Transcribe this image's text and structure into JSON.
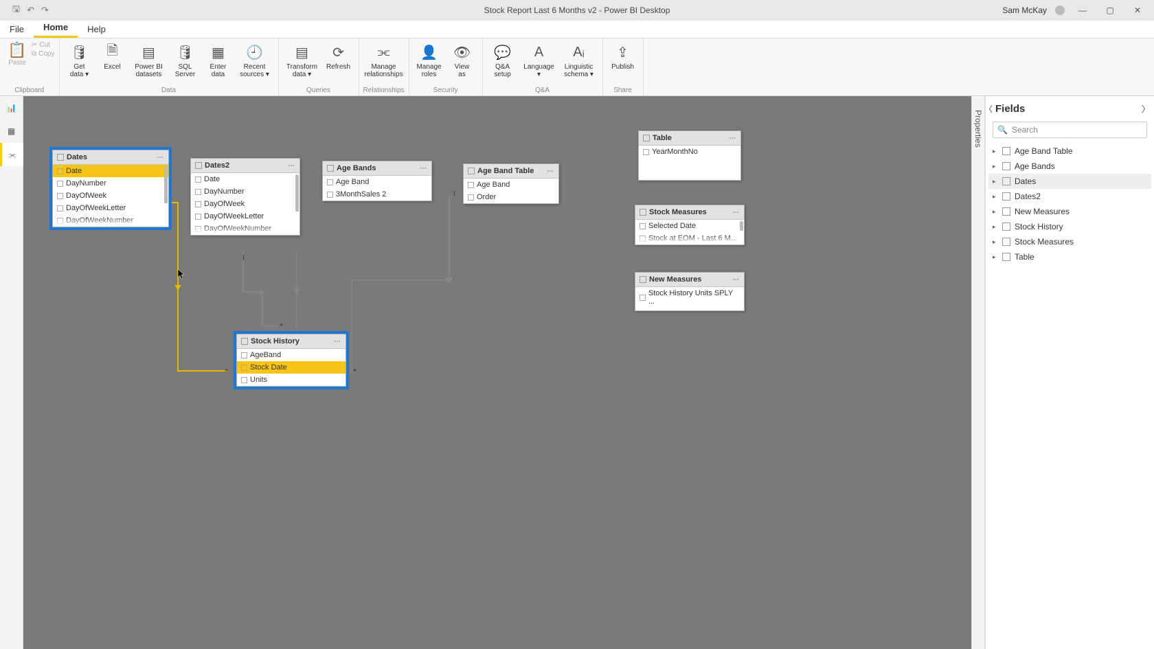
{
  "app": {
    "title": "Stock Report Last 6 Months v2 - Power BI Desktop",
    "user": "Sam McKay"
  },
  "menu": {
    "file": "File",
    "home": "Home",
    "help": "Help"
  },
  "ribbon": {
    "clipboard": {
      "paste": "Paste",
      "cut": "Cut",
      "copy": "Copy",
      "group": "Clipboard"
    },
    "data": {
      "get": "Get\ndata ▾",
      "excel": "Excel",
      "pbi": "Power BI\ndatasets",
      "sql": "SQL\nServer",
      "enter": "Enter\ndata",
      "recent": "Recent\nsources ▾",
      "group": "Data"
    },
    "queries": {
      "transform": "Transform\ndata ▾",
      "refresh": "Refresh",
      "group": "Queries"
    },
    "relationships": {
      "manage": "Manage\nrelationships",
      "group": "Relationships"
    },
    "security": {
      "roles": "Manage\nroles",
      "view": "View\nas",
      "group": "Security"
    },
    "qa": {
      "setup": "Q&A\nsetup",
      "lang": "Language\n▾",
      "schema": "Linguistic\nschema ▾",
      "group": "Q&A"
    },
    "share": {
      "publish": "Publish",
      "group": "Share"
    }
  },
  "proptab": "Properties",
  "fields": {
    "title": "Fields",
    "search_ph": "Search",
    "tables": [
      {
        "name": "Age Band Table",
        "sel": false
      },
      {
        "name": "Age Bands",
        "sel": false
      },
      {
        "name": "Dates",
        "sel": true
      },
      {
        "name": "Dates2",
        "sel": false
      },
      {
        "name": "New Measures",
        "sel": false
      },
      {
        "name": "Stock History",
        "sel": false
      },
      {
        "name": "Stock Measures",
        "sel": false
      },
      {
        "name": "Table",
        "sel": false
      }
    ]
  },
  "diagram": {
    "dates": {
      "title": "Dates",
      "fields": [
        "Date",
        "DayNumber",
        "DayOfWeek",
        "DayOfWeekLetter",
        "DayOfWeekNumber"
      ],
      "highlight": "Date"
    },
    "dates2": {
      "title": "Dates2",
      "fields": [
        "Date",
        "DayNumber",
        "DayOfWeek",
        "DayOfWeekLetter",
        "DayOfWeekNumber"
      ]
    },
    "agebands": {
      "title": "Age Bands",
      "fields": [
        "Age Band",
        "3MonthSales 2"
      ]
    },
    "agebandtable": {
      "title": "Age Band Table",
      "fields": [
        "Age Band",
        "Order"
      ]
    },
    "table": {
      "title": "Table",
      "fields": [
        "YearMonthNo"
      ]
    },
    "stockmeasures": {
      "title": "Stock Measures",
      "fields": [
        "Selected Date",
        "Stock at EOM - Last 6 M..."
      ]
    },
    "newmeasures": {
      "title": "New Measures",
      "fields": [
        "Stock History Units SPLY ..."
      ]
    },
    "stockhistory": {
      "title": "Stock History",
      "fields": [
        "AgeBand",
        "Stock Date",
        "Units"
      ],
      "highlight": "Stock Date"
    }
  }
}
